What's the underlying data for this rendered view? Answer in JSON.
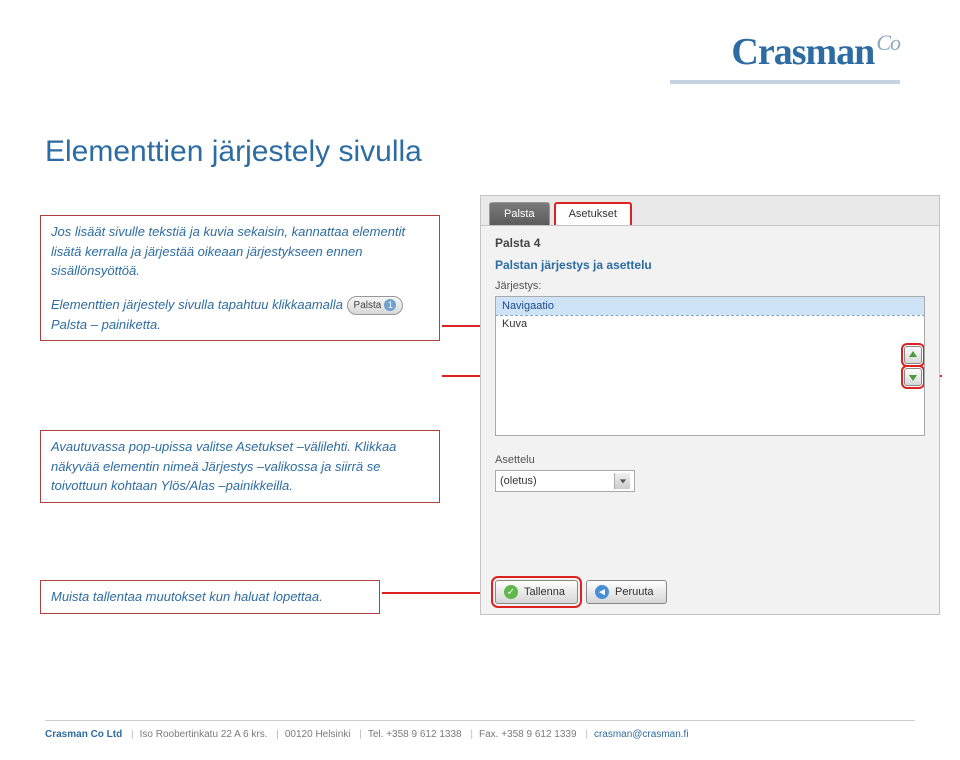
{
  "logo": {
    "name": "Crasman",
    "suffix": "Co"
  },
  "page_title": "Elementtien järjestely sivulla",
  "text1": {
    "p1": "Jos lisäät sivulle tekstiä ja kuvia sekaisin, kannattaa elementit lisätä kerralla ja järjestää oikeaan järjestykseen ennen sisällönsyöttöä.",
    "p2a": "Elementtien järjestely sivulla tapahtuu klikkaamalla ",
    "btn_label": "Palsta",
    "btn_num": "1",
    "p2b": " Palsta – painiketta."
  },
  "text2": "Avautuvassa pop-upissa valitse Asetukset –välilehti. Klikkaa näkyvää elementin nimeä Järjestys –valikossa ja siirrä se toivottuun kohtaan Ylös/Alas –painikkeilla.",
  "text3": "Muista tallentaa muutokset kun haluat lopettaa.",
  "panel": {
    "tabs": [
      "Palsta",
      "Asetukset"
    ],
    "column_title": "Palsta 4",
    "subheading": "Palstan järjestys ja asettelu",
    "order_label": "Järjestys:",
    "items": [
      "Navigaatio",
      "Kuva"
    ],
    "layout_label": "Asettelu",
    "layout_value": "(oletus)",
    "save": "Tallenna",
    "cancel": "Peruuta"
  },
  "footer": {
    "company": "Crasman Co Ltd",
    "address": "Iso Roobertinkatu 22 A 6 krs.",
    "postal": "00120 Helsinki",
    "tel": "Tel. +358 9 612 1338",
    "fax": "Fax. +358 9 612 1339",
    "email": "crasman@crasman.fi"
  }
}
